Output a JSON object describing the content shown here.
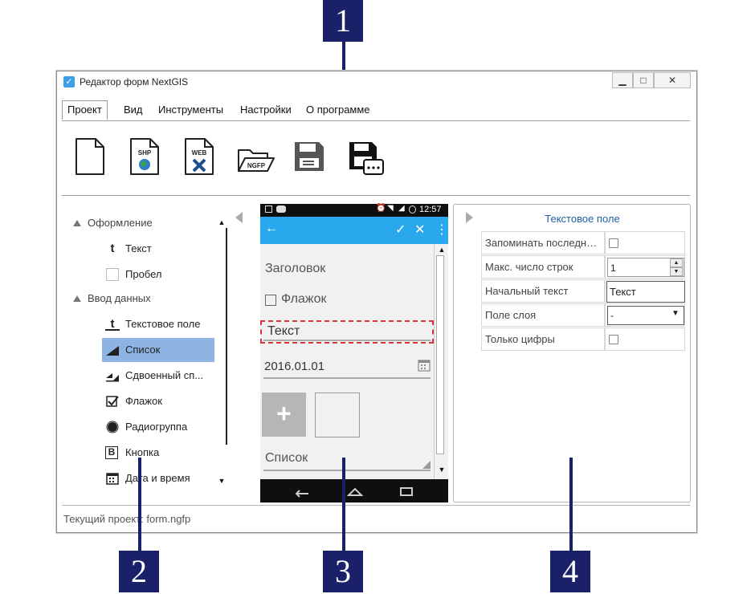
{
  "callouts": [
    "1",
    "2",
    "3",
    "4"
  ],
  "window": {
    "title": "Редактор форм NextGIS",
    "controls": {
      "minimize": "▁",
      "maximize": "□",
      "close": "✕"
    }
  },
  "menu": {
    "tabs": [
      "Проект",
      "Вид",
      "Инструменты",
      "Настройки",
      "О программе"
    ]
  },
  "toolbar": {
    "shp_label": "SHP",
    "web_label": "WEB",
    "ngfp_label": "NGFP"
  },
  "elements": {
    "section_design": "Оформление",
    "text": "Текст",
    "space": "Пробел",
    "section_input": "Ввод данных",
    "text_field": "Текстовое поле",
    "list": "Список",
    "double_list": "Сдвоенный сп...",
    "checkbox": "Флажок",
    "radio_group": "Радиогруппа",
    "button": "Кнопка",
    "date_time": "Дата и время",
    "button_icon_letter": "B"
  },
  "phone": {
    "time": "12:57",
    "header": "Заголовок",
    "checkbox": "Флажок",
    "text_field": "Текст",
    "date": "2016.01.01",
    "list": "Список",
    "plus": "+"
  },
  "properties": {
    "title": "Текстовое поле",
    "rows": [
      {
        "key": "Запоминать последнее значение",
        "type": "checkbox",
        "value": ""
      },
      {
        "key": "Макс. число строк",
        "type": "spin",
        "value": "1"
      },
      {
        "key": "Начальный текст",
        "type": "text",
        "value": "Текст"
      },
      {
        "key": "Поле слоя",
        "type": "combo",
        "value": "-"
      },
      {
        "key": "Только цифры",
        "type": "checkbox",
        "value": ""
      }
    ]
  },
  "status": {
    "text": "Текущий проект: form.ngfp"
  },
  "colors": {
    "callout": "#1b2169",
    "selection": "#8db4e2",
    "appbar": "#2aa8ee",
    "highlight_dash": "#d9323a",
    "title_blue": "#1f5fa6"
  }
}
